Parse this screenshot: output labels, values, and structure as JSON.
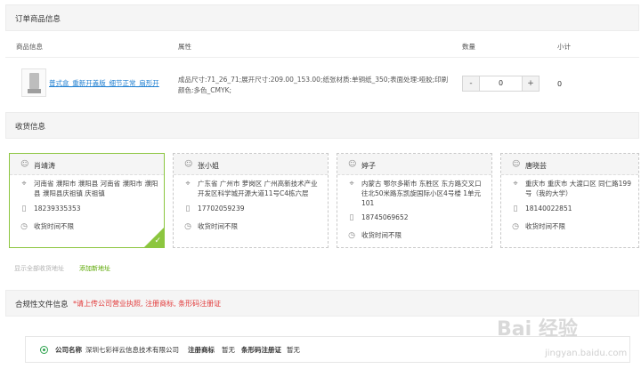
{
  "order_section": {
    "title": "订单商品信息",
    "columns": [
      "商品信息",
      "属性",
      "数量",
      "小计"
    ],
    "item": {
      "name": "普式盒_重新开盖版_细节正常_扇形开",
      "attributes": "成品尺寸:71_26_71;展开尺寸:209.00_153.00;纸张材质:单铜纸_350;表面处理:哑胶;印刷颜色:多色_CMYK;",
      "quantity": "0",
      "subtotal": "0",
      "minus_label": "-",
      "plus_label": "+"
    }
  },
  "address_section": {
    "title": "收货信息",
    "cards": [
      {
        "name": "肖靖涛",
        "address": "河南省 濮阳市 濮阳县 河南省 濮阳市 濮阳县 濮阳县庆祖镇 庆祖镇",
        "phone": "18239335353",
        "time": "收货时间不限",
        "selected": true
      },
      {
        "name": "张小姐",
        "address": "广东省 广州市 萝岗区 广州高新技术产业开发区科学城开源大道11号C4栋六层",
        "phone": "17702059239",
        "time": "收货时间不限",
        "selected": false
      },
      {
        "name": "婷子",
        "address": "内蒙古 鄂尔多斯市 东胜区 东方路交叉口往北50米路东凯旋国际小区4号楼 1单元101",
        "phone": "18745069652",
        "time": "收货时间不限",
        "selected": false
      },
      {
        "name": "唐晓芸",
        "address": "重庆市 重庆市 大渡口区 同仁路199号（我的大学）",
        "phone": "18140022851",
        "time": "收货时间不限",
        "selected": false
      }
    ],
    "show_all_link": "显示全部收货地址",
    "add_link": "添加新地址"
  },
  "compliance_section": {
    "title": "合规性文件信息",
    "notice": "*请上传公司营业执照, 注册商标, 条形码注册证",
    "company_label": "公司名称",
    "company_name": "深圳七彩祥云信息技术有限公司",
    "trademark_label": "注册商标",
    "trademark_value": "暂无",
    "barcode_label": "条形码注册证",
    "barcode_value": "暂无"
  },
  "watermark": {
    "brand": "Bai 经验",
    "url": "jingyan.baidu.com"
  },
  "colors": {
    "accent_green": "#8cc63f",
    "link_blue": "#1f7fd1",
    "notice_red": "#e23b3b"
  }
}
